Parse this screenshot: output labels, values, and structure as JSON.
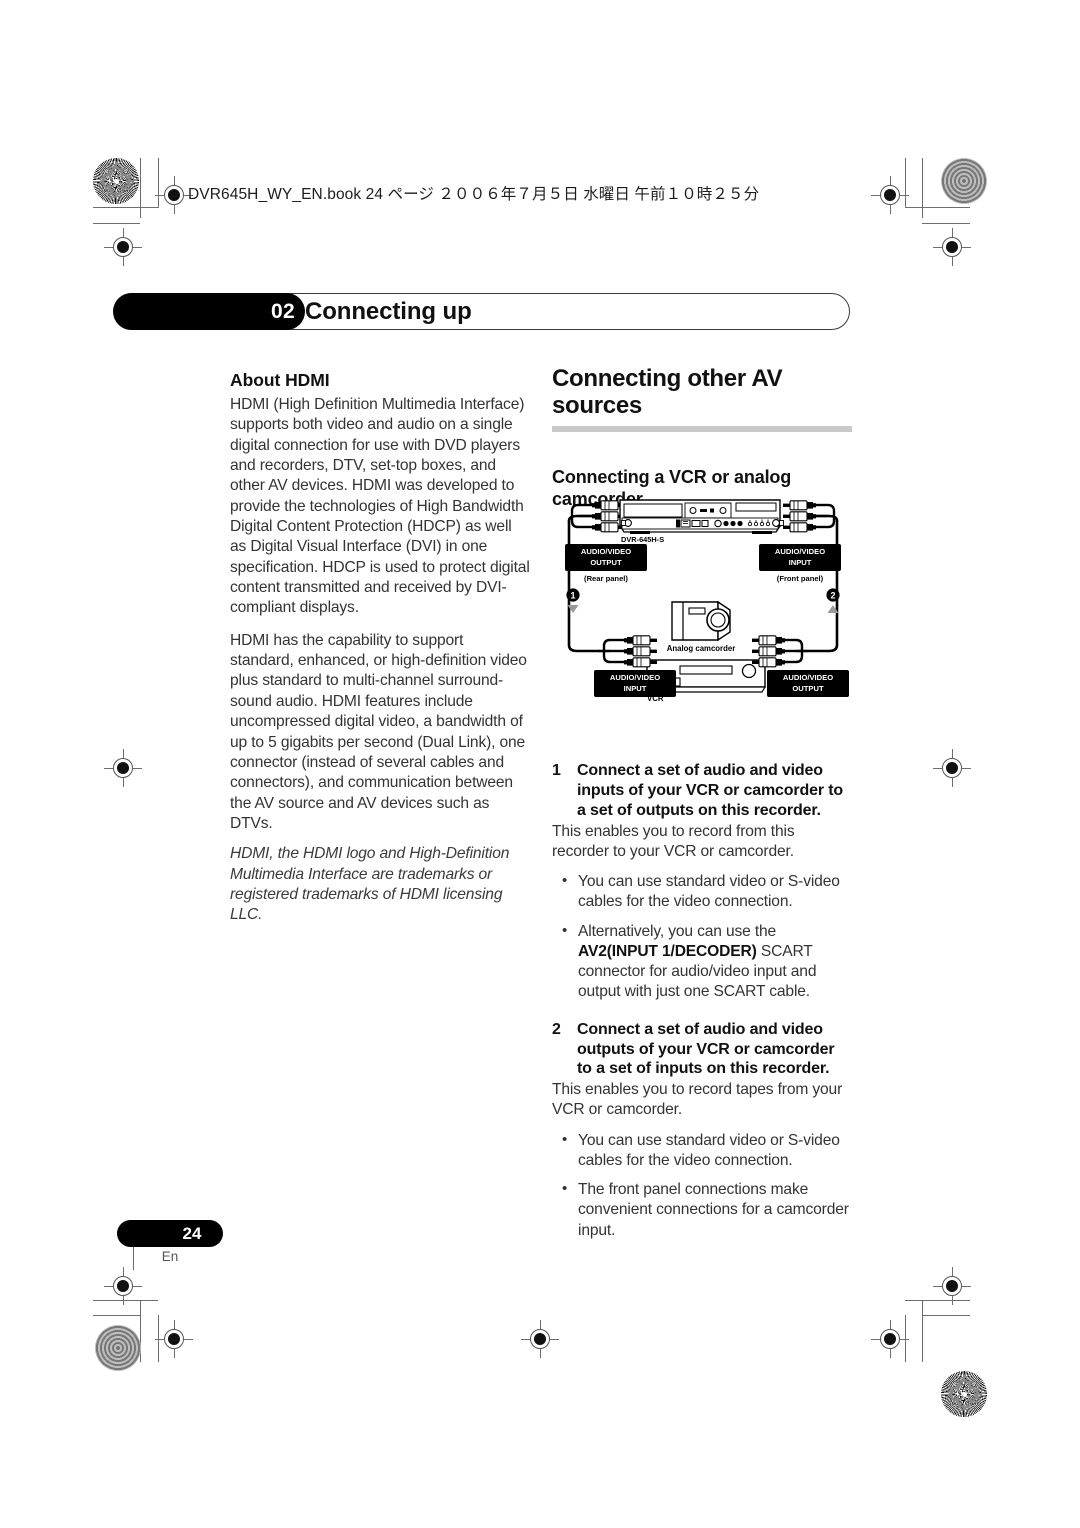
{
  "print_header": {
    "text": "DVR645H_WY_EN.book 24 ページ ２００６年７月５日  水曜日  午前１０時２５分"
  },
  "chapter": {
    "number": "02",
    "title": "Connecting up"
  },
  "left_column": {
    "heading": "About HDMI",
    "paragraph_1": "HDMI (High Definition Multimedia Interface) supports both video and audio on a single digital connection for use with DVD players and recorders, DTV, set-top boxes, and other AV devices. HDMI was developed to provide the technologies of High Bandwidth Digital Content Protection (HDCP) as well as Digital Visual Interface (DVI) in one specification. HDCP is used to protect digital content transmitted and received by DVI-compliant displays.",
    "paragraph_2": "HDMI has the capability to support standard, enhanced, or high-definition video plus standard to multi-channel surround-sound audio. HDMI features include uncompressed digital video, a bandwidth of up to 5 gigabits per second (Dual Link), one connector (instead of several cables and connectors), and communication between the AV source and AV devices such as DTVs.",
    "trademark_note": "HDMI, the HDMI logo and High-Definition Multimedia Interface are trademarks or registered trademarks of HDMI licensing LLC."
  },
  "right_column": {
    "section_heading": "Connecting other AV sources",
    "subheading": "Connecting a VCR or analog camcorder",
    "steps": [
      {
        "number": "1",
        "heading": "Connect a set of audio and video inputs of your VCR or camcorder to a set of outputs on this recorder.",
        "body": "This enables you to record from this recorder to your VCR or camcorder.",
        "bullets": [
          {
            "text_before": "You can use standard video or S-video cables for the video connection.",
            "bold": "",
            "text_after": ""
          },
          {
            "text_before": "Alternatively, you can use the ",
            "bold": "AV2(INPUT 1/DECODER)",
            "text_after": " SCART connector for audio/video input and output with just one SCART cable."
          }
        ]
      },
      {
        "number": "2",
        "heading": "Connect a set of audio and video outputs of your VCR or camcorder to a set of inputs on this recorder.",
        "body": "This enables you to record tapes from your VCR or camcorder.",
        "bullets": [
          {
            "text_before": "You can use standard video or S-video cables for the video connection.",
            "bold": "",
            "text_after": ""
          },
          {
            "text_before": "The front panel connections make convenient connections for a camcorder input.",
            "bold": "",
            "text_after": ""
          }
        ]
      }
    ]
  },
  "diagram": {
    "recorder_model": "DVR-645H-S",
    "labels": {
      "top_left_line1": "AUDIO/VIDEO",
      "top_left_line2": "OUTPUT",
      "top_left_note": "(Rear panel)",
      "top_right_line1": "AUDIO/VIDEO",
      "top_right_line2": "INPUT",
      "top_right_note": "(Front panel)",
      "bottom_left_line1": "AUDIO/VIDEO",
      "bottom_left_line2": "INPUT",
      "bottom_right_line1": "AUDIO/VIDEO",
      "bottom_right_line2": "OUTPUT",
      "camcorder": "Analog camcorder",
      "vcr": "VCR",
      "callout_1": "1",
      "callout_2": "2"
    }
  },
  "footer": {
    "page_number": "24",
    "language": "En"
  }
}
